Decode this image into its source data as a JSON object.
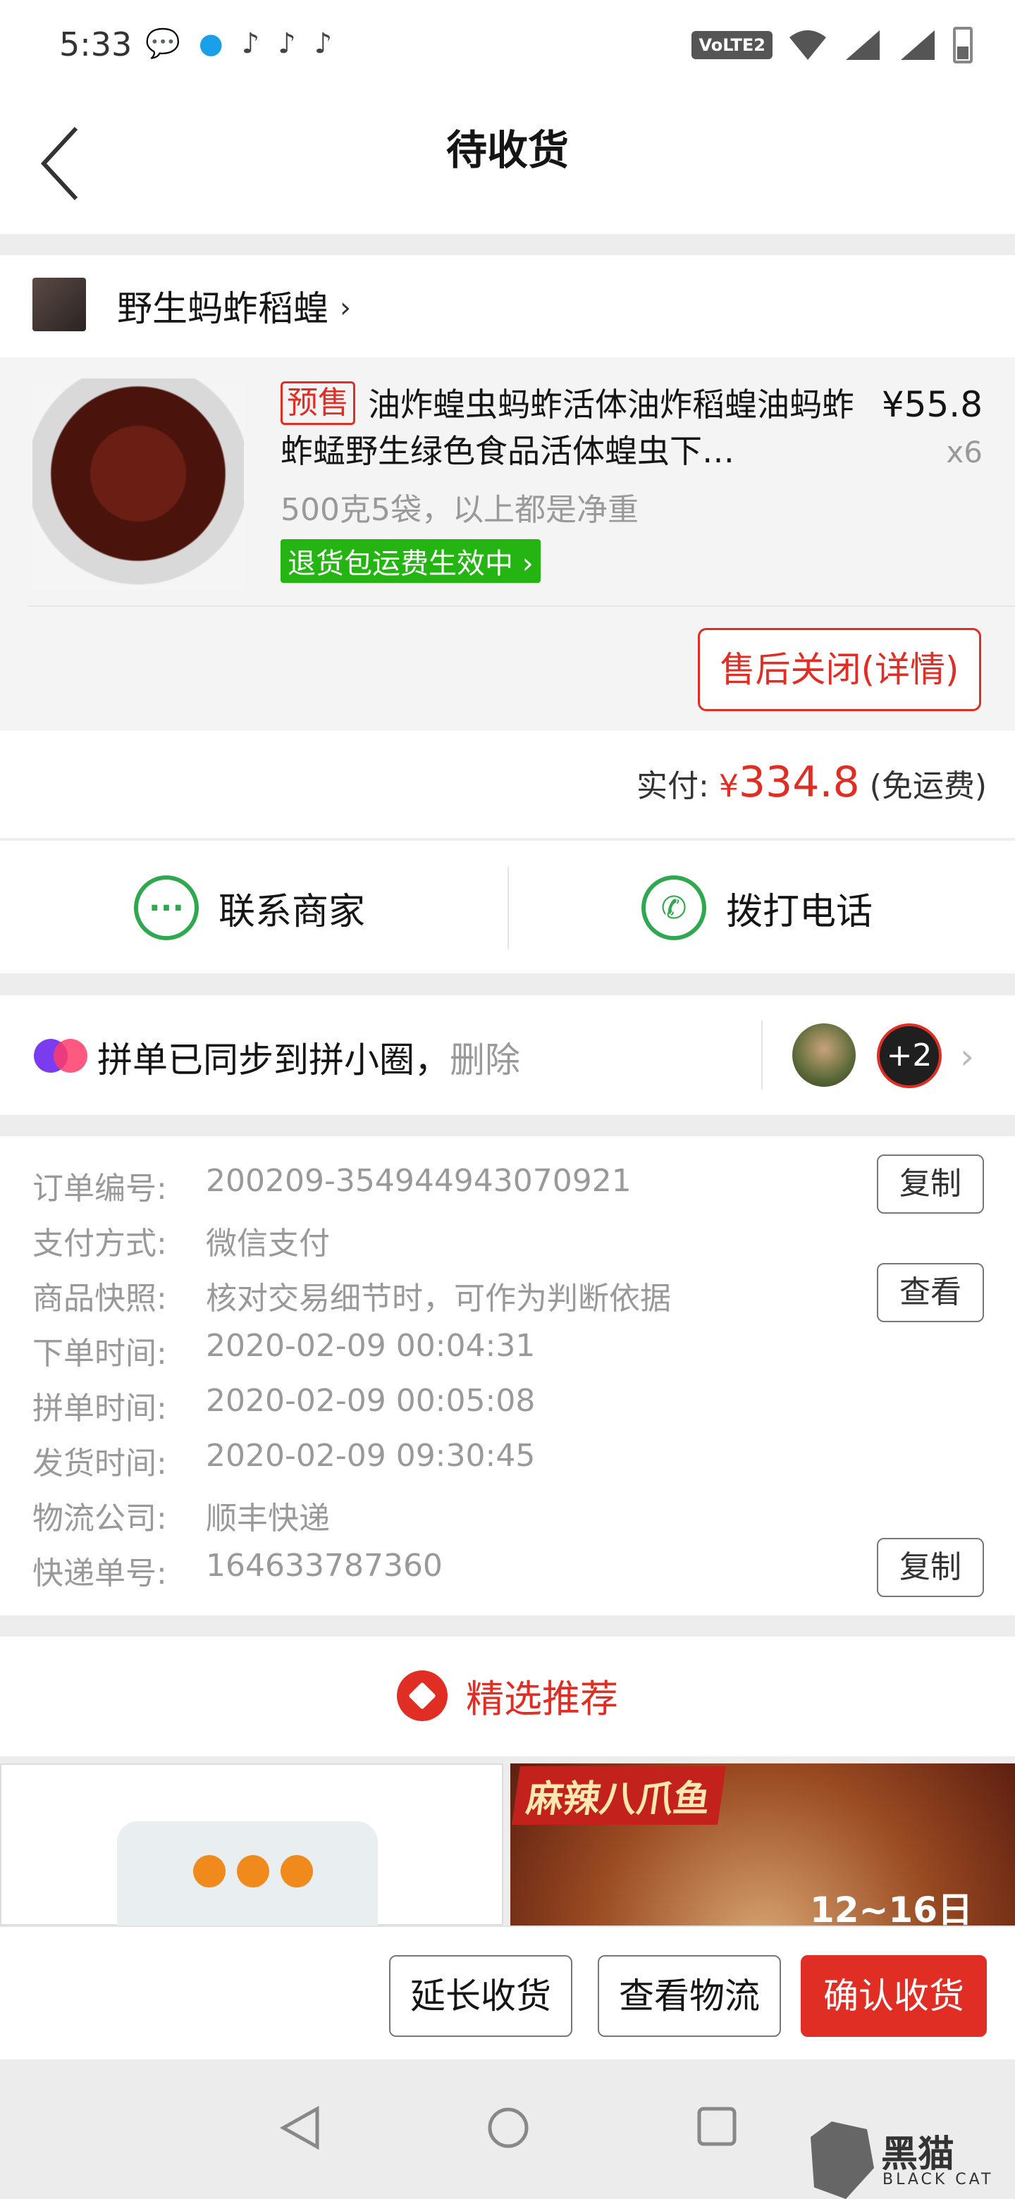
{
  "status_bar": {
    "time": "5:33",
    "app_icons": [
      "wechat-icon",
      "qq-icon",
      "tiktok-icon",
      "tiktok-icon",
      "tiktok-icon"
    ],
    "network_label": "VoLTE2"
  },
  "nav": {
    "title": "待收货"
  },
  "store": {
    "name": "野生蚂蚱稻蝗"
  },
  "goods": {
    "presale_tag": "预售",
    "title": "油炸蝗虫蚂蚱活体油炸稻蝗油蚂蚱蚱蜢野生绿色食品活体蝗虫下…",
    "price": "¥55.8",
    "qty": "x6",
    "spec": "500克5袋，以上都是净重",
    "return_tag": "退货包运费生效中",
    "aftersale_button": "售后关闭(详情)"
  },
  "payment": {
    "label": "实付:",
    "currency": "¥",
    "amount": "334.8",
    "note": "(免运费)"
  },
  "contact": {
    "merchant_label": "联系商家",
    "phone_label": "拨打电话"
  },
  "group": {
    "text": "拼单已同步到拼小圈，",
    "delete_label": "删除",
    "more_count": "+2"
  },
  "order_info": {
    "rows": [
      {
        "label": "订单编号:",
        "value": "200209-354944943070921"
      },
      {
        "label": "支付方式:",
        "value": "微信支付"
      },
      {
        "label": "商品快照:",
        "value": "核对交易细节时，可作为判断依据"
      },
      {
        "label": "下单时间:",
        "value": "2020-02-09 00:04:31"
      },
      {
        "label": "拼单时间:",
        "value": "2020-02-09 00:05:08"
      },
      {
        "label": "发货时间:",
        "value": "2020-02-09 09:30:45"
      },
      {
        "label": "物流公司:",
        "value": "顺丰快递"
      },
      {
        "label": "快递单号:",
        "value": "164633787360"
      }
    ],
    "copy_label": "复制",
    "view_label": "查看",
    "copy_label_2": "复制"
  },
  "recommend": {
    "title": "精选推荐",
    "right_banner_label": "麻辣八爪鱼",
    "right_banner_date": "12~16日"
  },
  "bottom_bar": {
    "extend_label": "延长收货",
    "logistics_label": "查看物流",
    "confirm_label": "确认收货"
  },
  "watermark": {
    "text": "黑猫",
    "sub": "BLACK CAT"
  },
  "colors": {
    "accent": "#e02e24",
    "green": "#25b513",
    "contact_green": "#2fa84f"
  }
}
